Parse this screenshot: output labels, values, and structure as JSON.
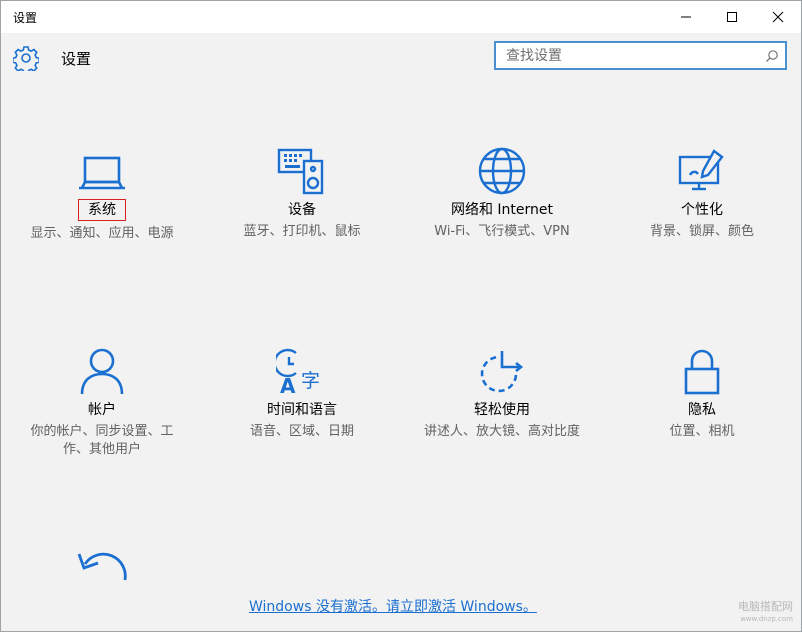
{
  "window": {
    "title": "设置",
    "controls": [
      {
        "name": "minimize-icon"
      },
      {
        "name": "maximize-icon"
      },
      {
        "name": "close-icon"
      }
    ]
  },
  "header": {
    "icon": "gear-icon",
    "title": "设置",
    "search_placeholder": "查找设置",
    "search_icon": "search-icon"
  },
  "tiles": [
    {
      "id": "system",
      "icon": "laptop-icon",
      "title": "系统",
      "desc": "显示、通知、应用、电源",
      "highlighted": true
    },
    {
      "id": "devices",
      "icon": "devices-icon",
      "title": "设备",
      "desc": "蓝牙、打印机、鼠标"
    },
    {
      "id": "network",
      "icon": "globe-icon",
      "title": "网络和 Internet",
      "desc": "Wi-Fi、飞行模式、VPN"
    },
    {
      "id": "personalization",
      "icon": "personalization-icon",
      "title": "个性化",
      "desc": "背景、锁屏、颜色"
    },
    {
      "id": "accounts",
      "icon": "user-icon",
      "title": "帐户",
      "desc": "你的帐户、同步设置、工作、其他用户"
    },
    {
      "id": "time-language",
      "icon": "time-language-icon",
      "title": "时间和语言",
      "desc": "语音、区域、日期"
    },
    {
      "id": "ease-of-access",
      "icon": "ease-of-access-icon",
      "title": "轻松使用",
      "desc": "讲述人、放大镜、高对比度"
    },
    {
      "id": "privacy",
      "icon": "lock-icon",
      "title": "隐私",
      "desc": "位置、相机"
    }
  ],
  "footer": {
    "back_icon": "update-icon",
    "activation_link": "Windows 没有激活。请立即激活 Windows。",
    "watermark_line1": "电脑搭配网",
    "watermark_line2": "www.dnzp.com"
  },
  "colors": {
    "accent": "#1a6fd1",
    "highlight_border": "#d52020",
    "background": "#f2f2f2"
  }
}
